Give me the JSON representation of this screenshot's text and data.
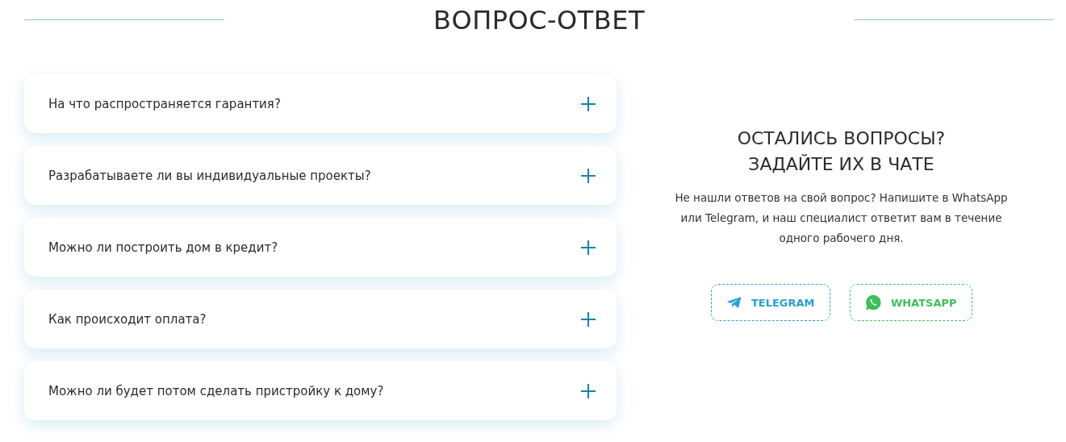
{
  "title": "ВОПРОС-ОТВЕТ",
  "faq": [
    {
      "question": "На что распространяется гарантия?",
      "expanded": false
    },
    {
      "question": "Разрабатываете ли вы индивидуальные проекты?",
      "expanded": false
    },
    {
      "question": "Можно ли построить дом в кредит?",
      "expanded": false
    },
    {
      "question": "Как происходит оплата?",
      "expanded": false
    },
    {
      "question": "Можно ли будет потом сделать пристройку к дому?",
      "expanded": false
    }
  ],
  "contact": {
    "heading_lines": [
      "ОСТАЛИСЬ ВОПРОСЫ?",
      "ЗАДАЙТЕ ИХ В ЧАТЕ"
    ],
    "text": "Не нашли ответов на свой вопрос? Напишите в WhatsApp или Telegram, и наш специалист ответит вам в течение одного рабочего дня.",
    "buttons": [
      {
        "kind": "telegram",
        "label": "TELEGRAM"
      },
      {
        "kind": "whatsapp",
        "label": "WHATSAPP"
      }
    ]
  }
}
